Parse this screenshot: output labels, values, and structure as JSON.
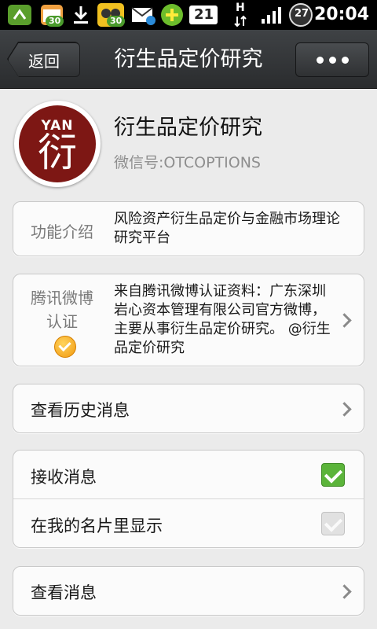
{
  "statusbar": {
    "badge_1": "30",
    "badge_2": "30",
    "mail_count": "21",
    "network": "H",
    "battery": "27",
    "time": "20:04"
  },
  "header": {
    "back_label": "返回",
    "title": "衍生品定价研究"
  },
  "profile": {
    "avatar_top": "YAN",
    "avatar_char": "衍",
    "name": "衍生品定价研究",
    "wechat_id": "微信号:OTCOPTIONS"
  },
  "intro": {
    "label": "功能介绍",
    "text": "风险资产衍生品定价与金融市场理论研究平台"
  },
  "weibo": {
    "label_line1": "腾讯微博",
    "label_line2": "认证",
    "text": "来自腾讯微博认证资料：广东深圳岩心资本管理有限公司官方微博，主要从事衍生品定价研究。 @衍生品定价研究"
  },
  "history": {
    "label": "查看历史消息"
  },
  "settings": {
    "receive_label": "接收消息",
    "receive_checked": true,
    "show_card_label": "在我的名片里显示",
    "show_card_checked": true
  },
  "view": {
    "label": "查看消息"
  }
}
